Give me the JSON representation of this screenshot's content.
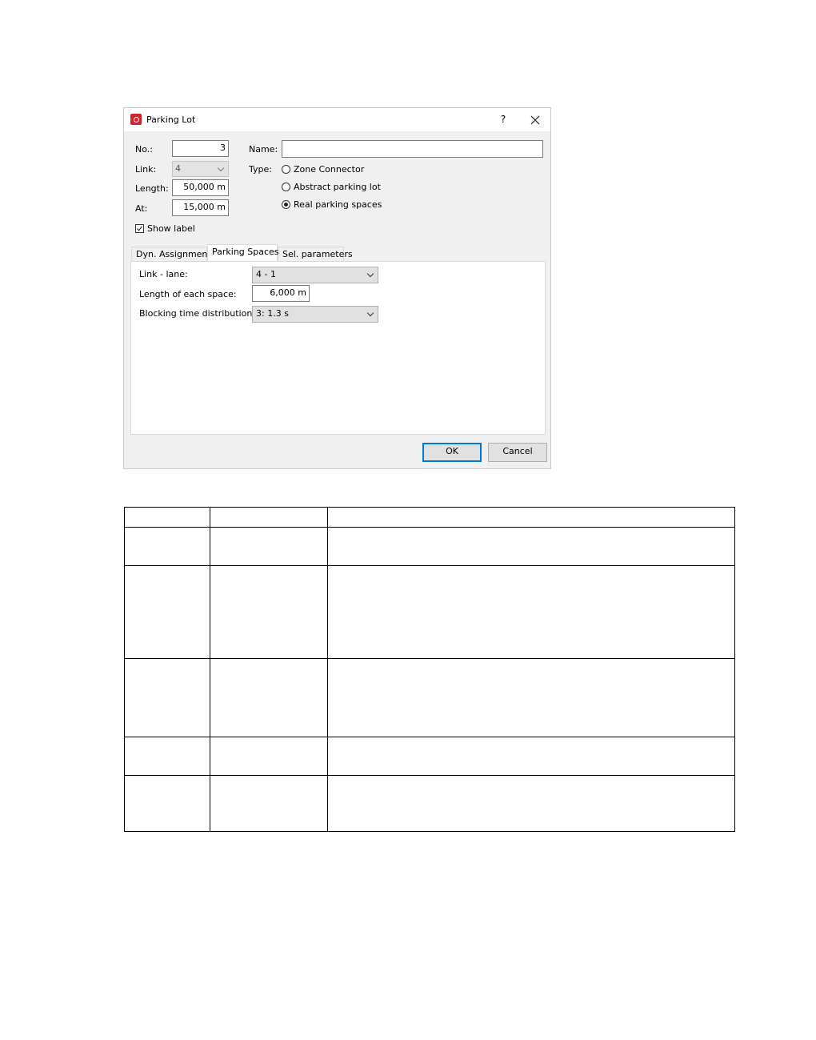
{
  "dialog": {
    "title": "Parking Lot",
    "help": "?",
    "no_label": "No.:",
    "no_value": "3",
    "link_label": "Link:",
    "link_value": "4",
    "length_label": "Length:",
    "length_value": "50,000 m",
    "at_label": "At:",
    "at_value": "15,000 m",
    "show_label": "Show label",
    "name_label": "Name:",
    "name_value": "",
    "type_label": "Type:",
    "type_options": [
      "Zone Connector",
      "Abstract parking lot",
      "Real parking spaces"
    ],
    "type_selected": "Real parking spaces",
    "tabs": [
      "Dyn. Assignment",
      "Parking Spaces",
      "Sel. parameters"
    ],
    "active_tab": "Parking Spaces",
    "parking_spaces": {
      "link_lane_label": "Link - lane:",
      "link_lane_value": "4 - 1",
      "length_each_label": "Length of each space:",
      "length_each_value": "6,000 m",
      "blocking_label": "Blocking time distribution:",
      "blocking_value": "3: 1.3 s"
    },
    "ok_label": "OK",
    "cancel_label": "Cancel"
  }
}
